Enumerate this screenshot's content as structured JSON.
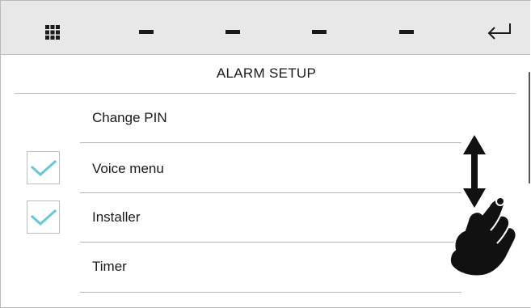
{
  "toolbar": {
    "menu_icon": "grid-icon",
    "slots": [
      "—",
      "—",
      "—",
      "—"
    ],
    "back_icon": "enter-return-icon"
  },
  "page": {
    "title": "ALARM SETUP"
  },
  "menu": {
    "items": [
      {
        "label": "Change PIN",
        "checked": false,
        "has_checkbox": false
      },
      {
        "label": "Voice menu",
        "checked": true,
        "has_checkbox": true
      },
      {
        "label": "Installer",
        "checked": true,
        "has_checkbox": true
      },
      {
        "label": "Timer",
        "checked": false,
        "has_checkbox": false
      }
    ]
  },
  "gesture_hint": {
    "icon": "hand-swipe-up-down-icon"
  },
  "colors": {
    "toolbar_bg": "#e8e8e8",
    "check_color": "#66c7dc",
    "text": "#1a1a1a"
  }
}
